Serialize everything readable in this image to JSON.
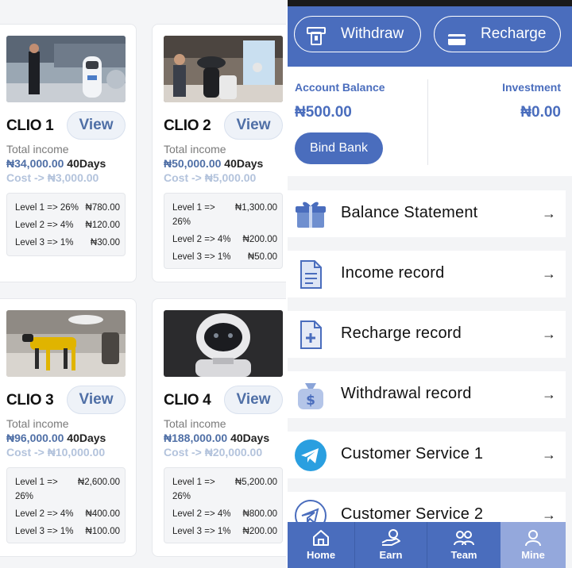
{
  "products": [
    {
      "name": "CLIO 1",
      "view": "View",
      "total_income_label": "Total income",
      "income": "₦34,000.00",
      "days": "40Days",
      "cost": "Cost -> ₦3,000.00",
      "levels": [
        {
          "label": "Level 1 => 26%",
          "value": "₦780.00"
        },
        {
          "label": "Level 2 => 4%",
          "value": "₦120.00"
        },
        {
          "label": "Level 3 => 1%",
          "value": "₦30.00"
        }
      ]
    },
    {
      "name": "CLIO 2",
      "view": "View",
      "total_income_label": "Total income",
      "income": "₦50,000.00",
      "days": "40Days",
      "cost": "Cost -> ₦5,000.00",
      "levels": [
        {
          "label": "Level 1 =>",
          "label2": "26%",
          "value": "₦1,300.00"
        },
        {
          "label": "Level 2 => 4%",
          "value": "₦200.00"
        },
        {
          "label": "Level 3 => 1%",
          "value": "₦50.00"
        }
      ]
    },
    {
      "name": "CLIO 3",
      "view": "View",
      "total_income_label": "Total income",
      "income": "₦96,000.00",
      "days": "40Days",
      "cost": "Cost -> ₦10,000.00",
      "levels": [
        {
          "label": "Level 1 =>",
          "label2": "26%",
          "value": "₦2,600.00"
        },
        {
          "label": "Level 2 => 4%",
          "value": "₦400.00"
        },
        {
          "label": "Level 3 => 1%",
          "value": "₦100.00"
        }
      ]
    },
    {
      "name": "CLIO 4",
      "view": "View",
      "total_income_label": "Total income",
      "income": "₦188,000.00",
      "days": "40Days",
      "cost": "Cost -> ₦20,000.00",
      "levels": [
        {
          "label": "Level 1 =>",
          "label2": "26%",
          "value": "₦5,200.00"
        },
        {
          "label": "Level 2 => 4%",
          "value": "₦800.00"
        },
        {
          "label": "Level 3 => 1%",
          "value": "₦200.00"
        }
      ]
    }
  ],
  "actions": {
    "withdraw": "Withdraw",
    "recharge": "Recharge"
  },
  "account": {
    "balance_label": "Account Balance",
    "balance_value": "₦500.00",
    "investment_label": "Investment",
    "investment_value": "₦0.00",
    "bind_bank": "Bind Bank"
  },
  "menu": [
    {
      "label": "Balance Statement",
      "icon": "gift-icon"
    },
    {
      "label": "Income record",
      "icon": "document-icon"
    },
    {
      "label": "Recharge record",
      "icon": "file-plus-icon"
    },
    {
      "label": "Withdrawal record",
      "icon": "money-bag-icon"
    },
    {
      "label": "Customer Service 1",
      "icon": "telegram-icon"
    },
    {
      "label": "Customer Service 2",
      "icon": "telegram-outline-icon"
    }
  ],
  "menu_arrow": "→",
  "nav": [
    {
      "label": "Home",
      "icon": "home-icon"
    },
    {
      "label": "Earn",
      "icon": "earn-icon"
    },
    {
      "label": "Team",
      "icon": "team-icon"
    },
    {
      "label": "Mine",
      "icon": "user-icon",
      "active": true
    }
  ],
  "colors": {
    "brand": "#4a6dbd",
    "nav_active": "#94a8dc",
    "cost_text": "#b3c3dc"
  }
}
